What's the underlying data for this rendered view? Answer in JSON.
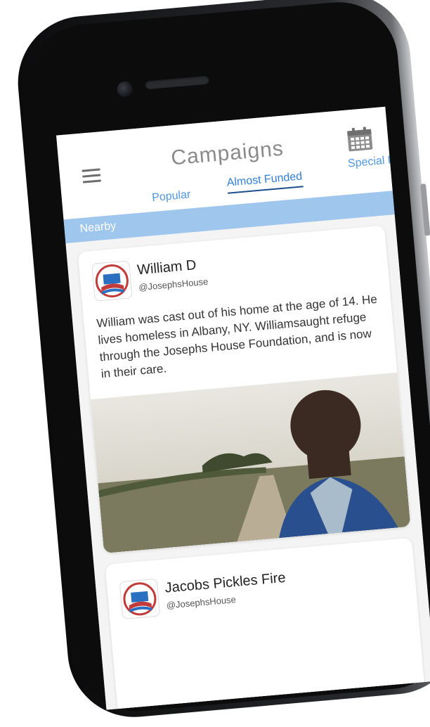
{
  "header": {
    "title": "Campaigns",
    "menu_icon": "hamburger-menu-icon",
    "calendar_icon": "calendar-icon"
  },
  "tabs": [
    {
      "label": "Nearby"
    },
    {
      "label": "Popular"
    },
    {
      "label": "Almost Funded",
      "active": true
    },
    {
      "label": "Special F"
    }
  ],
  "campaigns": [
    {
      "name": "William D",
      "handle": "@JosephsHouse",
      "description": "William was cast out of his home at the age of 14. He lives homeless in Albany, NY. Williamsaught refuge through the Josephs House Foundation, and is now in their care.",
      "image_icon": "campaign-photo-icon"
    },
    {
      "name": "Jacobs Pickles Fire",
      "handle": "@JosephsHouse"
    }
  ],
  "colors": {
    "tab_text": "#4f97e3",
    "tab_bar": "#9fc6ec",
    "title": "#8a8a8a"
  }
}
